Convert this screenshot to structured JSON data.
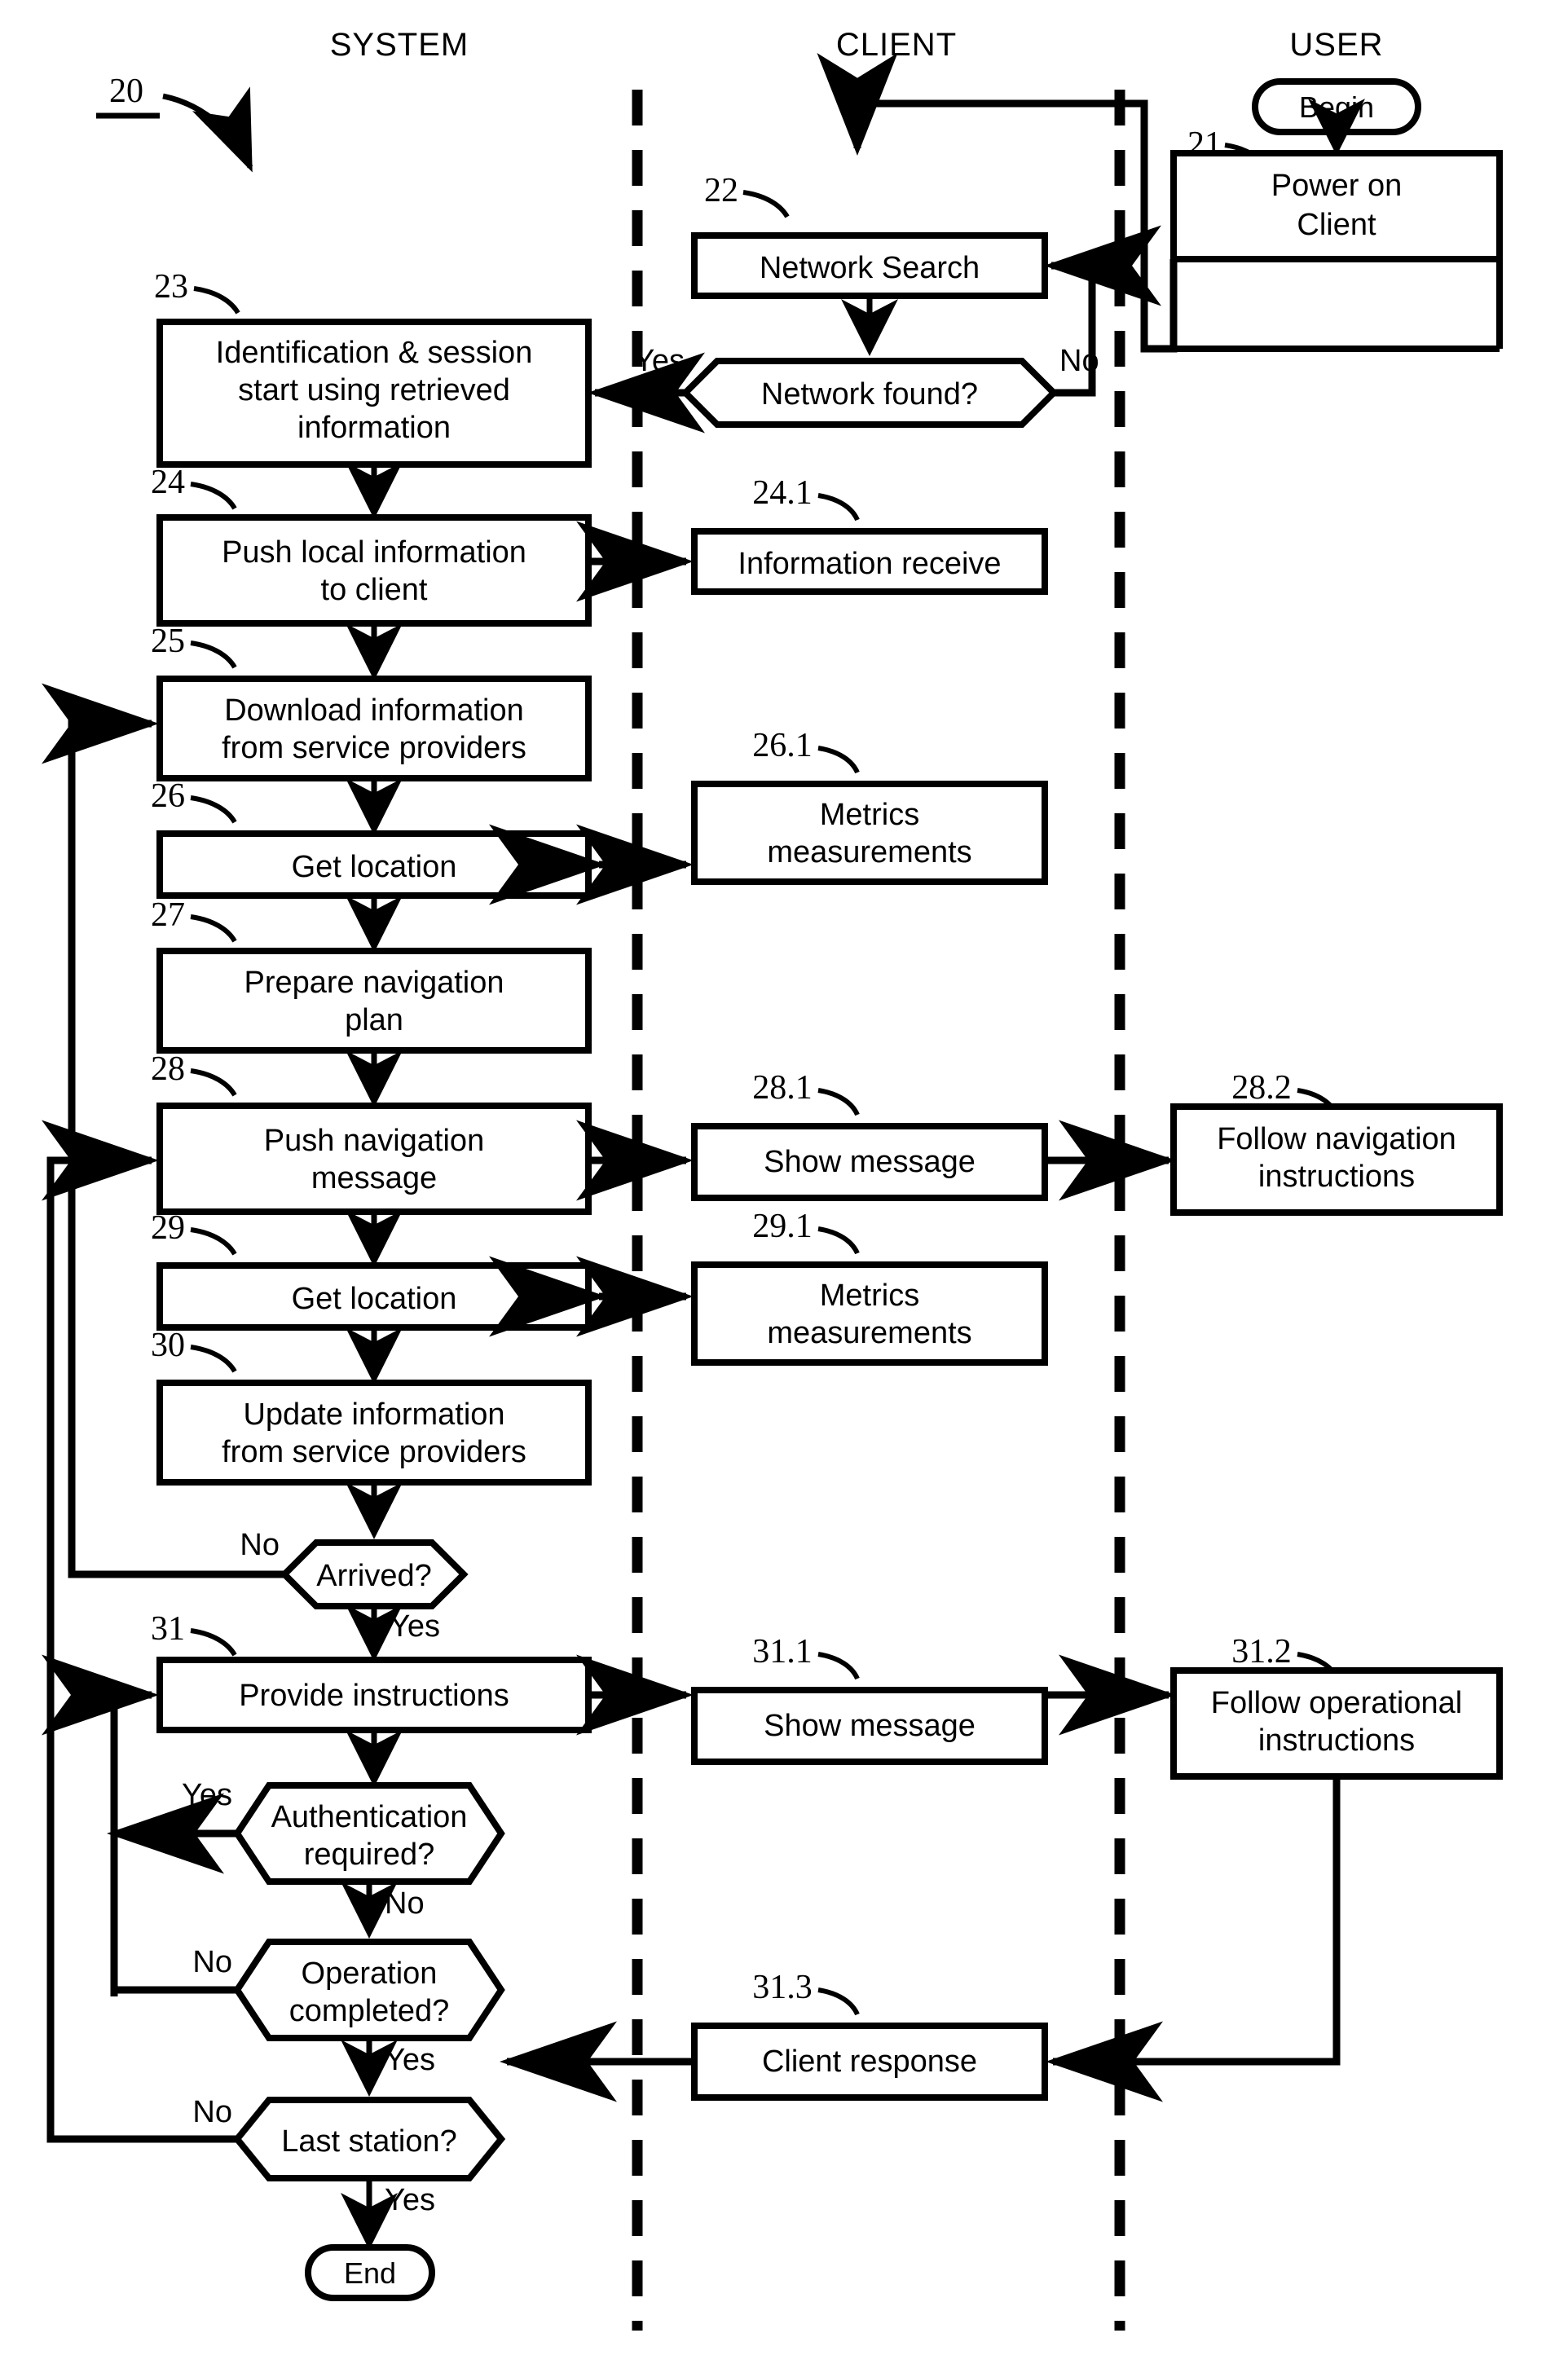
{
  "figure": {
    "ref_label": "20",
    "lanes": [
      {
        "name": "system",
        "title": "SYSTEM"
      },
      {
        "name": "client",
        "title": "CLIENT"
      },
      {
        "name": "user",
        "title": "USER"
      }
    ],
    "terminators": {
      "begin": "Begin",
      "end": "End"
    },
    "nodes": {
      "n21": {
        "ref": "21",
        "label_line1": "Power on",
        "label_line2": "Client",
        "lane": "user"
      },
      "n22": {
        "ref": "22",
        "label_line1": "Network Search",
        "lane": "client"
      },
      "n22d": {
        "label_line1": "Network found?",
        "lane": "client",
        "yes": "Yes",
        "no": "No"
      },
      "n23": {
        "ref": "23",
        "label_line1": "Identification & session",
        "label_line2": "start using retrieved",
        "label_line3": "information",
        "lane": "system"
      },
      "n24": {
        "ref": "24",
        "label_line1": "Push local information",
        "label_line2": "to client",
        "lane": "system"
      },
      "n241": {
        "ref": "24.1",
        "label_line1": "Information receive",
        "lane": "client"
      },
      "n25": {
        "ref": "25",
        "label_line1": "Download information",
        "label_line2": "from service providers",
        "lane": "system"
      },
      "n26": {
        "ref": "26",
        "label_line1": "Get location",
        "lane": "system"
      },
      "n261": {
        "ref": "26.1",
        "label_line1": "Metrics",
        "label_line2": "measurements",
        "lane": "client"
      },
      "n27": {
        "ref": "27",
        "label_line1": "Prepare navigation",
        "label_line2": "plan",
        "lane": "system"
      },
      "n28": {
        "ref": "28",
        "label_line1": "Push navigation",
        "label_line2": "message",
        "lane": "system"
      },
      "n281": {
        "ref": "28.1",
        "label_line1": "Show message",
        "lane": "client"
      },
      "n282": {
        "ref": "28.2",
        "label_line1": "Follow navigation",
        "label_line2": "instructions",
        "lane": "user"
      },
      "n29": {
        "ref": "29",
        "label_line1": "Get location",
        "lane": "system"
      },
      "n291": {
        "ref": "29.1",
        "label_line1": "Metrics",
        "label_line2": "measurements",
        "lane": "client"
      },
      "n30": {
        "ref": "30",
        "label_line1": "Update information",
        "label_line2": "from service providers",
        "lane": "system"
      },
      "n30d": {
        "label_line1": "Arrived?",
        "lane": "system",
        "yes": "Yes",
        "no": "No"
      },
      "n31": {
        "ref": "31",
        "label_line1": "Provide instructions",
        "lane": "system"
      },
      "n311": {
        "ref": "31.1",
        "label_line1": "Show message",
        "lane": "client"
      },
      "n312": {
        "ref": "31.2",
        "label_line1": "Follow operational",
        "label_line2": "instructions",
        "lane": "user"
      },
      "n313": {
        "ref": "31.3",
        "label_line1": "Client response",
        "lane": "client"
      },
      "n31d1": {
        "label_line1": "Authentication",
        "label_line2": "required?",
        "lane": "system",
        "yes": "Yes",
        "no": "No"
      },
      "n31d2": {
        "label_line1": "Operation",
        "label_line2": "completed?",
        "lane": "system",
        "yes": "Yes",
        "no": "No"
      },
      "n31d3": {
        "label_line1": "Last station?",
        "lane": "system",
        "yes": "Yes",
        "no": "No"
      }
    },
    "colors": {
      "ink": "#000000",
      "paper": "#ffffff"
    }
  }
}
